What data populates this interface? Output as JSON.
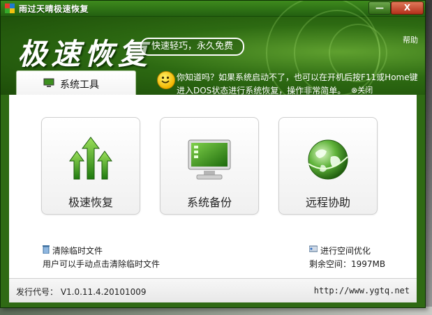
{
  "window": {
    "title": "雨过天晴极速恢复",
    "minimize": "—",
    "close": "X"
  },
  "header": {
    "logo": "极速恢复",
    "slogan": "快速轻巧，永久免费",
    "help": "帮助"
  },
  "tab": {
    "label": "系统工具"
  },
  "tip": {
    "line1": "你知道吗？如果系统启动不了，也可以在开机后按F11或Home键",
    "line2": "进入DOS状态进行系统恢复，操作非常简单。",
    "close": "⊗关闭"
  },
  "cards": [
    {
      "label": "极速恢复",
      "icon": "green-arrows-up-icon"
    },
    {
      "label": "系统备份",
      "icon": "monitor-icon"
    },
    {
      "label": "远程协助",
      "icon": "globe-icon"
    }
  ],
  "clean": {
    "link": "清除临时文件",
    "desc": "用户可以手动点击清除临时文件"
  },
  "optimize": {
    "link": "进行空间优化",
    "space": "剩余空间：1997MB"
  },
  "status": {
    "version": "发行代号： V1.0.11.4.20101009",
    "url": "http://www.ygtq.net"
  },
  "colors": {
    "theme_green": "#2f6a14",
    "close_red": "#b3301a",
    "accent_yellow": "#f3b600"
  }
}
